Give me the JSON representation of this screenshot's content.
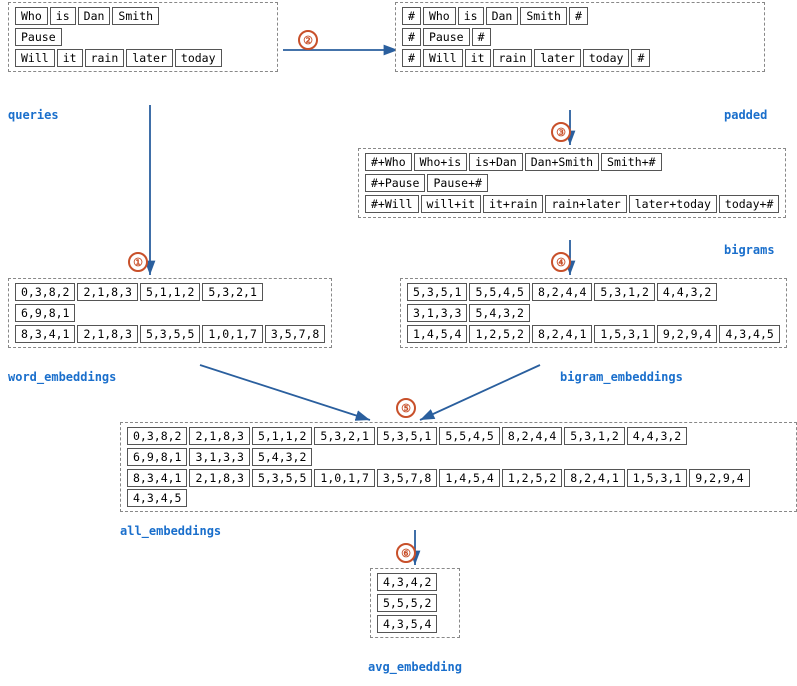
{
  "labels": {
    "queries": "queries",
    "padded": "padded",
    "bigrams": "bigrams",
    "word_embeddings": "word_embeddings",
    "bigram_embeddings": "bigram_embeddings",
    "all_embeddings": "all_embeddings",
    "avg_embedding": "avg_embedding"
  },
  "circles": [
    "①",
    "②",
    "③",
    "④",
    "⑤",
    "⑥"
  ],
  "queries": {
    "row1": [
      "Who",
      "is",
      "Dan",
      "Smith"
    ],
    "row2": [
      "Pause"
    ],
    "row3": [
      "Will",
      "it",
      "rain",
      "later",
      "today"
    ]
  },
  "padded": {
    "row1": [
      "#",
      "Who",
      "is",
      "Dan",
      "Smith",
      "#"
    ],
    "row2": [
      "#",
      "Pause",
      "#"
    ],
    "row3": [
      "#",
      "Will",
      "it",
      "rain",
      "later",
      "today",
      "#"
    ]
  },
  "bigrams": {
    "row1": [
      "#+Who",
      "Who+is",
      "is+Dan",
      "Dan+Smith",
      "Smith+#"
    ],
    "row2": [
      "#+Pause",
      "Pause+#"
    ],
    "row3": [
      "#+Will",
      "will+it",
      "it+rain",
      "rain+later",
      "later+today",
      "today+#"
    ]
  },
  "word_embeddings": {
    "row1": [
      "0,3,8,2",
      "2,1,8,3",
      "5,1,1,2",
      "5,3,2,1"
    ],
    "row2": [
      "6,9,8,1"
    ],
    "row3": [
      "8,3,4,1",
      "2,1,8,3",
      "5,3,5,5",
      "1,0,1,7",
      "3,5,7,8"
    ]
  },
  "bigram_embeddings": {
    "row1": [
      "5,3,5,1",
      "5,5,4,5",
      "8,2,4,4",
      "5,3,1,2",
      "4,4,3,2"
    ],
    "row2": [
      "3,1,3,3",
      "5,4,3,2"
    ],
    "row3": [
      "1,4,5,4",
      "1,2,5,2",
      "8,2,4,1",
      "1,5,3,1",
      "9,2,9,4",
      "4,3,4,5"
    ]
  },
  "all_embeddings": {
    "row1": [
      "0,3,8,2",
      "2,1,8,3",
      "5,1,1,2",
      "5,3,2,1",
      "5,3,5,1",
      "5,5,4,5",
      "8,2,4,4",
      "5,3,1,2",
      "4,4,3,2"
    ],
    "row2": [
      "6,9,8,1",
      "3,1,3,3",
      "5,4,3,2"
    ],
    "row3": [
      "8,3,4,1",
      "2,1,8,3",
      "5,3,5,5",
      "1,0,1,7",
      "3,5,7,8",
      "1,4,5,4",
      "1,2,5,2",
      "8,2,4,1",
      "1,5,3,1",
      "9,2,9,4",
      "4,3,4,5"
    ]
  },
  "avg_embedding": {
    "row1": [
      "4,3,4,2"
    ],
    "row2": [
      "5,5,5,2"
    ],
    "row3": [
      "4,3,5,4"
    ]
  }
}
